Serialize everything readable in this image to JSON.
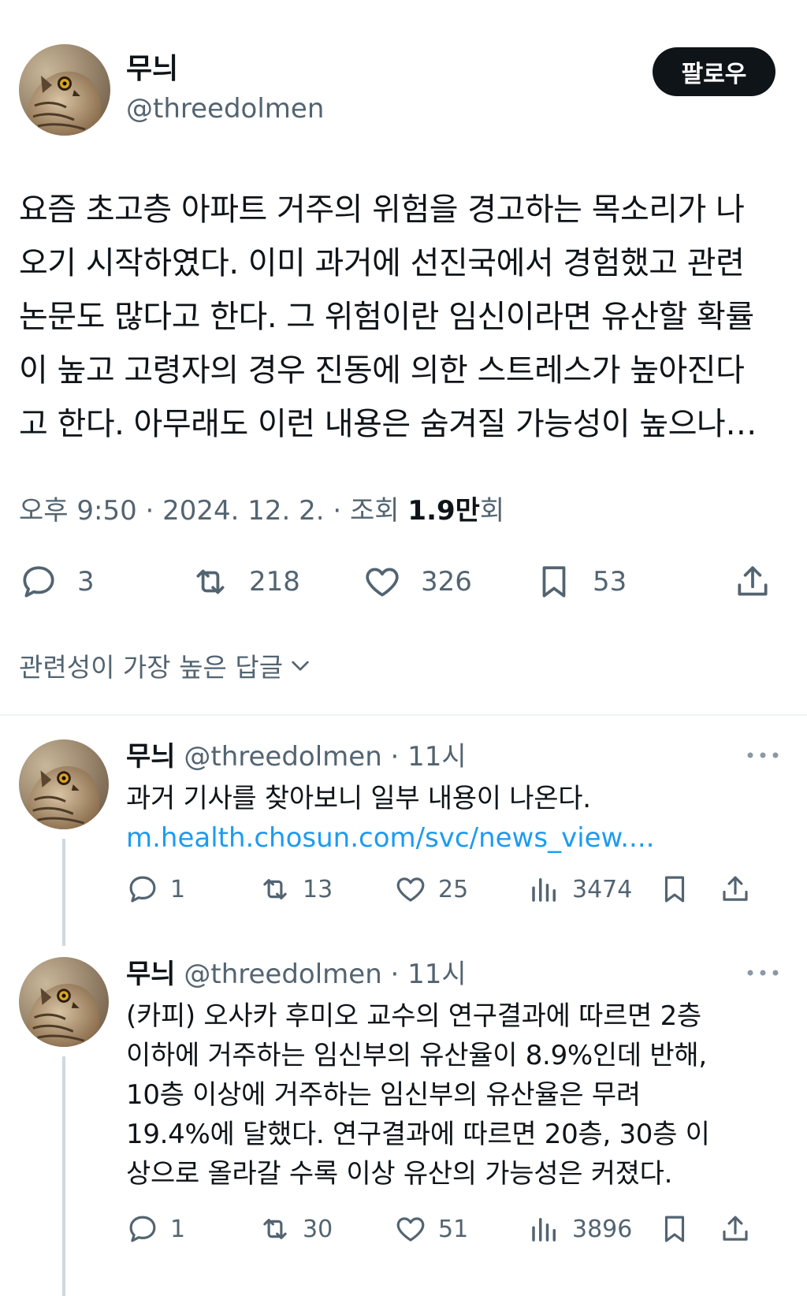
{
  "main_tweet": {
    "author_name": "무늬",
    "author_handle": "@threedolmen",
    "follow_label": "팔로우",
    "text_lines": [
      "요즘 초고층 아파트 거주의 위험을 경고하는 목소리가 나",
      "오기 시작하였다. 이미 과거에 선진국에서 경험했고 관련",
      "논문도 많다고 한다. 그 위험이란 임신이라면 유산할 확률",
      "이 높고 고령자의 경우 진동에 의한 스트레스가 높아진다",
      "고 한다. 아무래도 이런 내용은 숨겨질 가능성이 높으나…"
    ],
    "meta_time": "오후 9:50 · 2024. 12. 2. · 조회 ",
    "meta_views": "1.9만",
    "meta_views_suffix": "회",
    "replies_count": "3",
    "retweets_count": "218",
    "likes_count": "326",
    "bookmarks_count": "53"
  },
  "sort_label": "관련성이 가장 높은 답글",
  "replies": [
    {
      "author_name": "무늬",
      "author_handle": "@threedolmen · 11시",
      "text": "과거 기사를 찾아보니 일부 내용이 나온다.",
      "link": "m.health.chosun.com/svc/news_view....",
      "replies_count": "1",
      "retweets_count": "13",
      "likes_count": "25",
      "views_count": "3474"
    },
    {
      "author_name": "무늬",
      "author_handle": "@threedolmen · 11시",
      "text_lines": [
        "(카피) 오사카 후미오 교수의 연구결과에 따르면 2층",
        "이하에 거주하는 임신부의 유산율이 8.9%인데 반해,",
        "10층 이상에 거주하는 임신부의 유산율은 무려",
        "19.4%에 달했다. 연구결과에 따르면 20층, 30층 이",
        "상으로 올라갈 수록 이상 유산의 가능성은 커졌다."
      ],
      "replies_count": "1",
      "retweets_count": "30",
      "likes_count": "51",
      "views_count": "3896"
    }
  ],
  "colors": {
    "text": "#0f1419",
    "secondary": "#536471",
    "link": "#1d9bf0",
    "divider": "#eff3f4"
  }
}
